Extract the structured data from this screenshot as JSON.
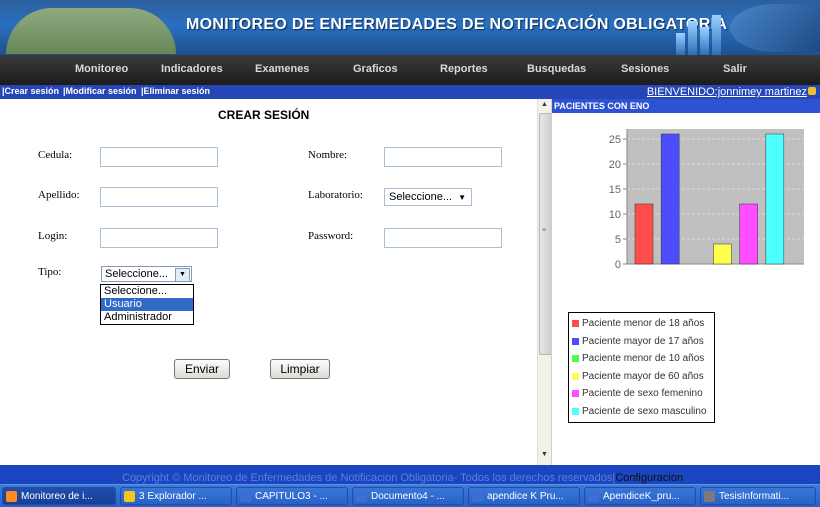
{
  "header": {
    "title": "MONITOREO DE ENFERMEDADES DE NOTIFICACIÓN OBLIGATORIA"
  },
  "nav": [
    "Monitoreo",
    "Indicadores",
    "Examenes",
    "Graficos",
    "Reportes",
    "Busquedas",
    "Sesiones",
    "Salir"
  ],
  "subnav": {
    "links": [
      "|Crear sesión",
      "|Modificar sesión",
      "|Eliminar sesión"
    ],
    "welcome": "BIENVENIDO:jonnimey martinez"
  },
  "form": {
    "title": "CREAR SESIÓN",
    "cedula_label": "Cedula:",
    "cedula_value": "",
    "nombre_label": "Nombre:",
    "nombre_value": "",
    "apellido_label": "Apellido:",
    "apellido_value": "",
    "laboratorio_label": "Laboratorio:",
    "laboratorio_value": "Seleccione...",
    "login_label": "Login:",
    "login_value": "",
    "password_label": "Password:",
    "password_value": "",
    "tipo_label": "Tipo:",
    "tipo_value": "Seleccione...",
    "tipo_options": [
      "Seleccione...",
      "Usuario",
      "Administrador"
    ],
    "tipo_highlighted": "Usuario",
    "enviar": "Enviar",
    "limpiar": "Limpiar"
  },
  "panel": {
    "title": "PACIENTES CON ENO"
  },
  "chart_data": {
    "type": "bar",
    "title": "",
    "xlabel": "",
    "ylabel": "",
    "ylim": [
      0,
      27
    ],
    "yticks": [
      "0",
      "5",
      "10",
      "15",
      "20",
      "25"
    ],
    "grid": true,
    "legend_position": "bottom",
    "series": [
      {
        "name": "Paciente menor de 18 años",
        "values": [
          12
        ],
        "color": "#ff4d4d"
      },
      {
        "name": "Paciente mayor de 17 años",
        "values": [
          26
        ],
        "color": "#4d4dff"
      },
      {
        "name": "Paciente menor de 10 años",
        "values": [
          0
        ],
        "color": "#4dff4d"
      },
      {
        "name": "Paciente mayor de 60 años",
        "values": [
          4
        ],
        "color": "#ffff4d"
      },
      {
        "name": "Paciente de sexo femenino",
        "values": [
          12
        ],
        "color": "#ff4dff"
      },
      {
        "name": "Paciente de sexo masculino",
        "values": [
          26
        ],
        "color": "#4dffff"
      }
    ]
  },
  "footer": {
    "copyright": "Copyright © Monitoreo de Enfermedades de Notificacion Obligatoria- Todos los derechos reservados|",
    "config": "Configuracion"
  },
  "taskbar": [
    {
      "label": "Monitoreo de i...",
      "color": "#ff8c1a"
    },
    {
      "label": "3 Explorador ...",
      "color": "#f5c518"
    },
    {
      "label": "CAPITULO3 - ...",
      "color": "#3b6fd6"
    },
    {
      "label": "Documento4 - ...",
      "color": "#3b6fd6"
    },
    {
      "label": "apendice K Pru...",
      "color": "#3b6fd6"
    },
    {
      "label": "ApendiceK_pru...",
      "color": "#3b6fd6"
    },
    {
      "label": "TesisInformati...",
      "color": "#7a7a7a"
    }
  ],
  "colors": {
    "header": "#2a6fc0",
    "nav": "#2b2b2b",
    "subbar": "#2646b8",
    "panel_title": "#2d52d2",
    "footer": "#1a45c0",
    "highlight": "#3169c6"
  }
}
